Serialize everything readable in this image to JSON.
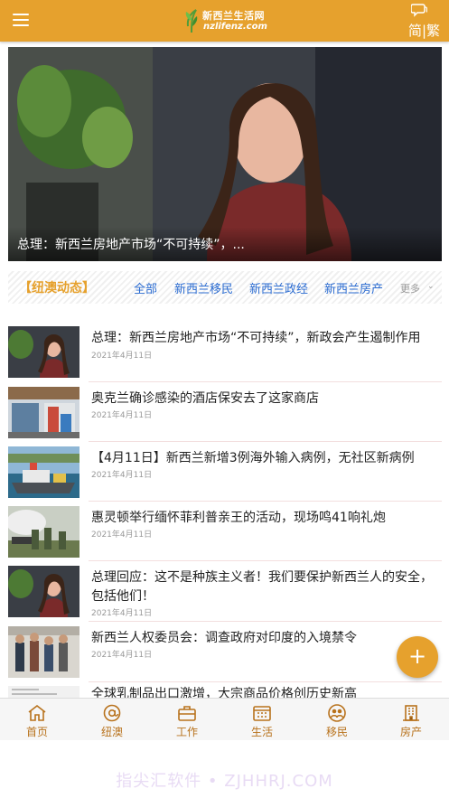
{
  "header": {
    "logo_cn": "新西兰生活网",
    "logo_en": "nzlifenz.com",
    "lang_switch": "简|繁"
  },
  "banner": {
    "caption": "总理：新西兰房地产市场“不可持续”，..."
  },
  "category_bar": {
    "title": "【纽澳动态】",
    "tabs": [
      "全部",
      "新西兰移民",
      "新西兰政经",
      "新西兰房产"
    ],
    "more": "更多"
  },
  "news": [
    {
      "title": "总理：新西兰房地产市场“不可持续”，新政会产生遏制作用",
      "date": "2021年4月11日",
      "thumb": "portrait"
    },
    {
      "title": "奥克兰确诊感染的酒店保安去了这家商店",
      "date": "2021年4月11日",
      "thumb": "store"
    },
    {
      "title": "【4月11日】新西兰新增3例海外输入病例，无社区新病例",
      "date": "2021年4月11日",
      "thumb": "ship"
    },
    {
      "title": "惠灵顿举行缅怀菲利普亲王的活动，现场鸣41响礼炮",
      "date": "2021年4月11日",
      "thumb": "cannon"
    },
    {
      "title": "总理回应：这不是种族主义者！我们要保护新西兰人的安全，包括他们！",
      "date": "2021年4月11日",
      "thumb": "portrait"
    },
    {
      "title": "新西兰人权委员会：调查政府对印度的入境禁令",
      "date": "2021年4月11日",
      "thumb": "airport"
    },
    {
      "title": "全球乳制品出口激增，大宗商品价格创历史新高",
      "date": "",
      "thumb": "document"
    }
  ],
  "fab": {
    "label": "+"
  },
  "bottom_nav": [
    {
      "label": "首页",
      "icon": "home-icon"
    },
    {
      "label": "纽澳",
      "icon": "at-icon"
    },
    {
      "label": "工作",
      "icon": "briefcase-icon"
    },
    {
      "label": "生活",
      "icon": "calendar-icon"
    },
    {
      "label": "移民",
      "icon": "people-icon"
    },
    {
      "label": "房产",
      "icon": "building-icon"
    }
  ],
  "watermark": "指尖汇软件 • ZJHHRJ.COM",
  "colors": {
    "brand": "#e6a12d",
    "tab_link": "#2a6bd1",
    "nav_label": "#b8721c"
  }
}
